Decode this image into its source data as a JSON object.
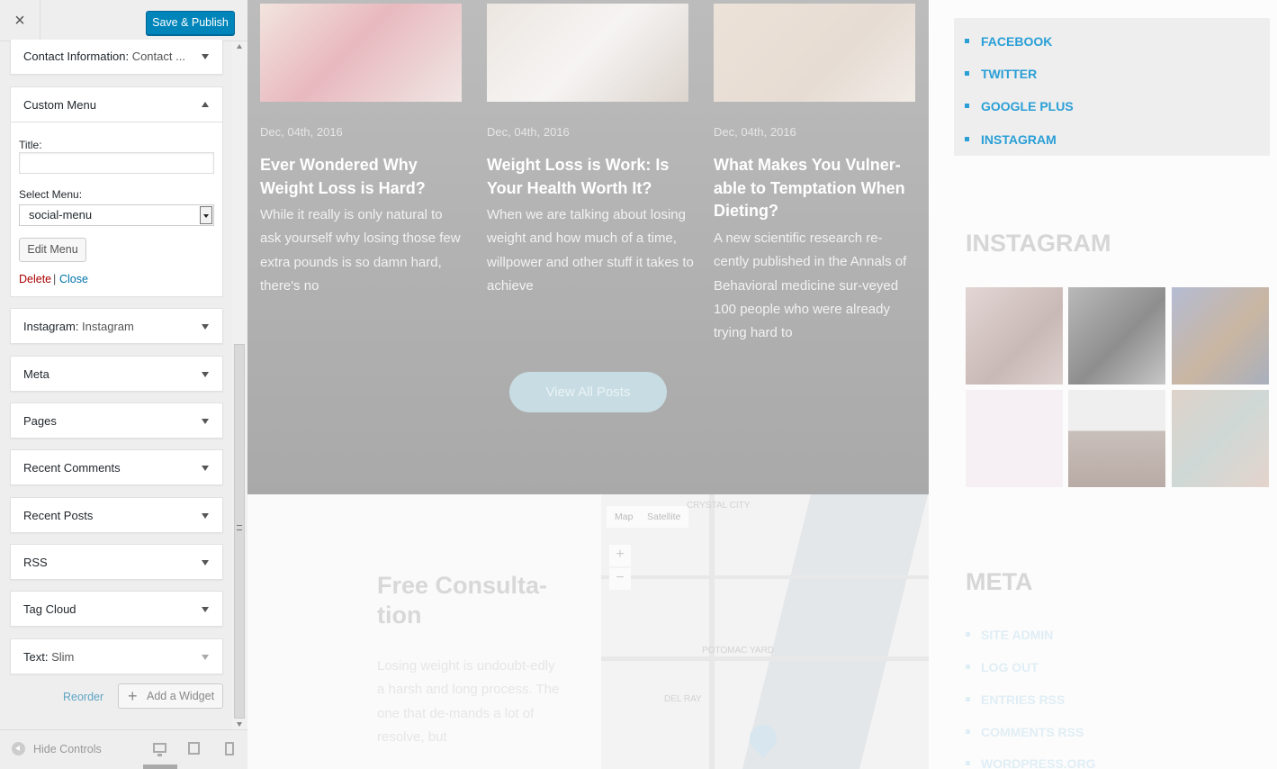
{
  "sidebar": {
    "close_symbol": "×",
    "publish_label": "Save & Publish",
    "contact_widget": {
      "title": "Contact Information:",
      "subtitle": "Contact ..."
    },
    "custom_menu": {
      "title": "Custom Menu",
      "title_label": "Title:",
      "title_value": "",
      "select_label": "Select Menu:",
      "select_value": "social-menu",
      "edit_label": "Edit Menu",
      "delete_label": "Delete",
      "separator": "|",
      "close_label": "Close"
    },
    "widgets": [
      {
        "title": "Instagram:",
        "subtitle": "Instagram"
      },
      {
        "title": "Meta",
        "subtitle": ""
      },
      {
        "title": "Pages",
        "subtitle": ""
      },
      {
        "title": "Recent Comments",
        "subtitle": ""
      },
      {
        "title": "Recent Posts",
        "subtitle": ""
      },
      {
        "title": "RSS",
        "subtitle": ""
      },
      {
        "title": "Tag Cloud",
        "subtitle": ""
      },
      {
        "title": "Text:",
        "subtitle": "Slim"
      }
    ],
    "reorder_label": "Reorder",
    "add_widget_label": "Add a Widget",
    "hide_controls_label": "Hide Controls"
  },
  "preview": {
    "posts": [
      {
        "date": "Dec, 04th, 2016",
        "title": "Ever Wondered Why Weight Loss is Hard?",
        "excerpt": "While it really is only natural to ask yourself why losing those few extra pounds is so damn hard, there's no"
      },
      {
        "date": "Dec, 04th, 2016",
        "title": "Weight Loss is Work: Is Your Health Worth It?",
        "excerpt": "When we are talking about losing weight and how much of a time, willpower and other stuff it takes to achieve"
      },
      {
        "date": "Dec, 04th, 2016",
        "title": "What Makes You Vulner-able to Temptation When Dieting?",
        "excerpt": "A new scientific research re-cently published in the Annals of Behavioral medicine sur-veyed 100 people who were already trying hard to"
      }
    ],
    "view_all_label": "View All Posts",
    "consultation": {
      "title": "Free Consulta-tion",
      "text": "Losing weight is undoubt-edly a harsh and long process. The one that de-mands a lot of resolve, but"
    },
    "map": {
      "tab_map": "Map",
      "tab_satellite": "Satellite",
      "zoom_in": "+",
      "zoom_out": "−",
      "labels": [
        "CRYSTAL CITY",
        "POTOMAC YARD",
        "DEL RAY"
      ]
    },
    "social_links": [
      "FACEBOOK",
      "TWITTER",
      "GOOGLE PLUS",
      "INSTAGRAM"
    ],
    "instagram_title": "INSTAGRAM",
    "meta_title": "META",
    "meta_links": [
      "SITE ADMIN",
      "LOG OUT",
      "ENTRIES RSS",
      "COMMENTS RSS",
      "WORDPRESS.ORG"
    ]
  },
  "colors": {
    "publish_button": "#0085ba",
    "link": "#0073aa",
    "delete": "#aa0000",
    "social_link": "#2a9fd6"
  },
  "icons": [
    "close-icon",
    "chevron-down-icon",
    "chevron-up-icon",
    "plus-icon",
    "hide-controls-icon",
    "desktop-icon",
    "tablet-icon",
    "mobile-icon",
    "map-pin-icon"
  ]
}
